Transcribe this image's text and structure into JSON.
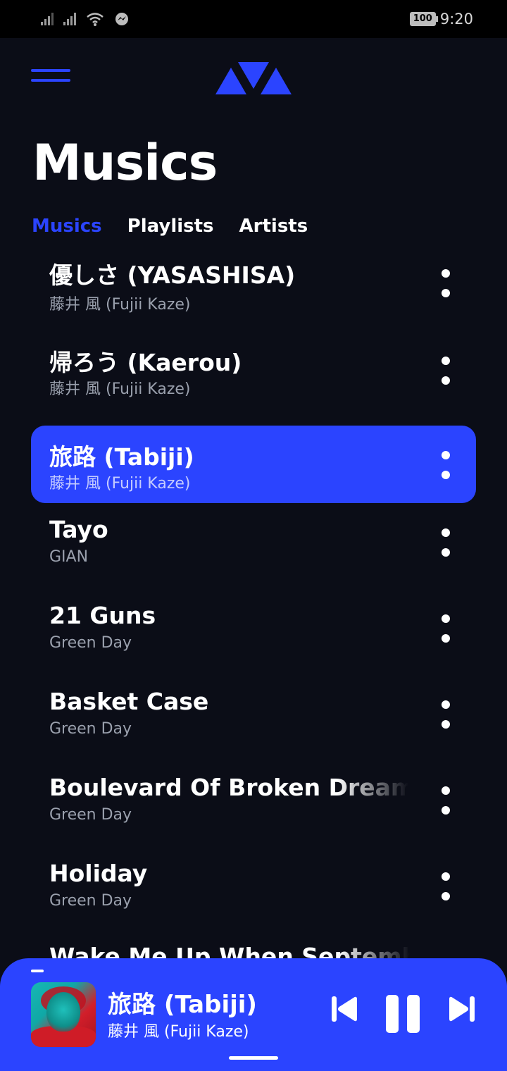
{
  "status_bar": {
    "time": "9:20",
    "battery": "100"
  },
  "page": {
    "title": "Musics"
  },
  "tabs": [
    {
      "label": "Musics",
      "active": true
    },
    {
      "label": "Playlists",
      "active": false
    },
    {
      "label": "Artists",
      "active": false
    }
  ],
  "songs": [
    {
      "title": "優しさ (YASASHISA)",
      "artist": "藤井 風 (Fujii Kaze)"
    },
    {
      "title": "帰ろう (Kaerou)",
      "artist": "藤井 風 (Fujii Kaze)"
    },
    {
      "title": "旅路 (Tabiji)",
      "artist": "藤井 風 (Fujii Kaze)",
      "active": true
    },
    {
      "title": "Tayo",
      "artist": "GIAN"
    },
    {
      "title": "21 Guns",
      "artist": "Green Day"
    },
    {
      "title": "Basket Case",
      "artist": "Green Day"
    },
    {
      "title": "Boulevard Of Broken Dreams",
      "artist": "Green Day"
    },
    {
      "title": "Holiday",
      "artist": "Green Day"
    },
    {
      "title": "Wake Me Up When September Ends",
      "artist": ""
    }
  ],
  "now_playing": {
    "title": "旅路 (Tabiji)",
    "artist": "藤井 風 (Fujii Kaze)"
  },
  "colors": {
    "accent": "#2b44ff",
    "background": "#0b0d17"
  },
  "icons": [
    "menu-icon",
    "app-logo",
    "more-vert-icon",
    "skip-previous-icon",
    "pause-icon",
    "skip-next-icon"
  ]
}
